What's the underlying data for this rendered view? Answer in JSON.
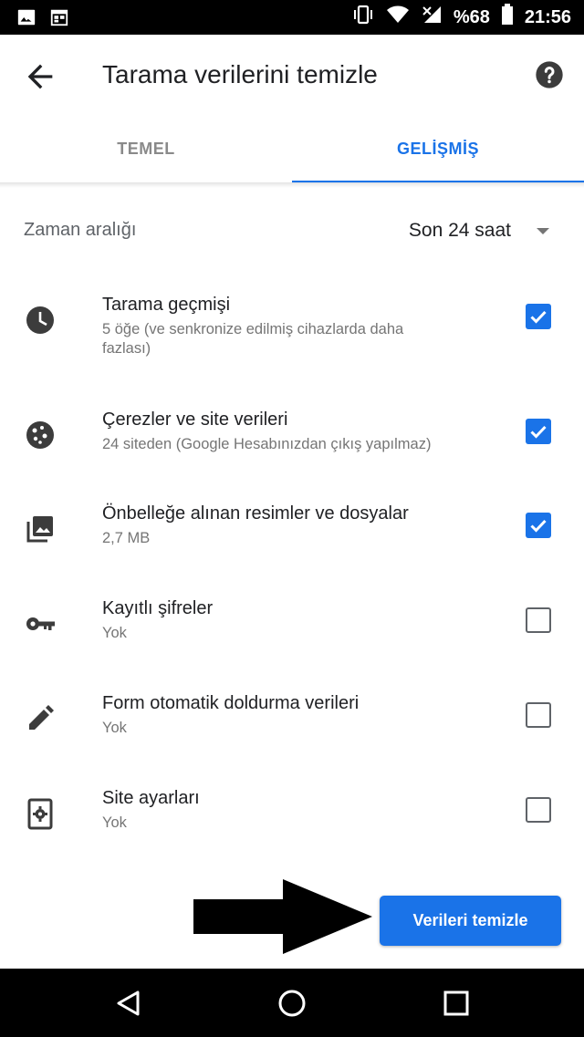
{
  "status_bar": {
    "battery": "%68",
    "time": "21:56",
    "left_icons": [
      "image-icon",
      "calendar-icon"
    ],
    "right_icons": [
      "vibrate-icon",
      "wifi-icon",
      "no-signal-icon",
      "battery-icon"
    ]
  },
  "header": {
    "title": "Tarama verilerini temizle",
    "back_icon": "back-arrow-icon",
    "help_icon": "help-icon"
  },
  "tabs": [
    {
      "label": "TEMEL",
      "selected": false
    },
    {
      "label": "GELİŞMİŞ",
      "selected": true
    }
  ],
  "time_range": {
    "label": "Zaman aralığı",
    "value": "Son 24 saat"
  },
  "items": [
    {
      "icon": "clock-icon",
      "title": "Tarama geçmişi",
      "subtitle": "5 öğe (ve senkronize edilmiş cihazlarda daha fazlası)",
      "checked": true
    },
    {
      "icon": "cookie-icon",
      "title": "Çerezler ve site verileri",
      "subtitle": "24 siteden (Google Hesabınızdan çıkış yapılmaz)",
      "checked": true
    },
    {
      "icon": "images-icon",
      "title": "Önbelleğe alınan resimler ve dosyalar",
      "subtitle": "2,7 MB",
      "checked": true
    },
    {
      "icon": "key-icon",
      "title": "Kayıtlı şifreler",
      "subtitle": "Yok",
      "checked": false
    },
    {
      "icon": "pencil-icon",
      "title": "Form otomatik doldurma verileri",
      "subtitle": "Yok",
      "checked": false
    },
    {
      "icon": "site-settings-icon",
      "title": "Site ayarları",
      "subtitle": "Yok",
      "checked": false
    }
  ],
  "action": {
    "clear_label": "Verileri temizle"
  },
  "colors": {
    "accent": "#1a73e8",
    "text_primary": "#202124",
    "text_secondary": "#757575"
  }
}
